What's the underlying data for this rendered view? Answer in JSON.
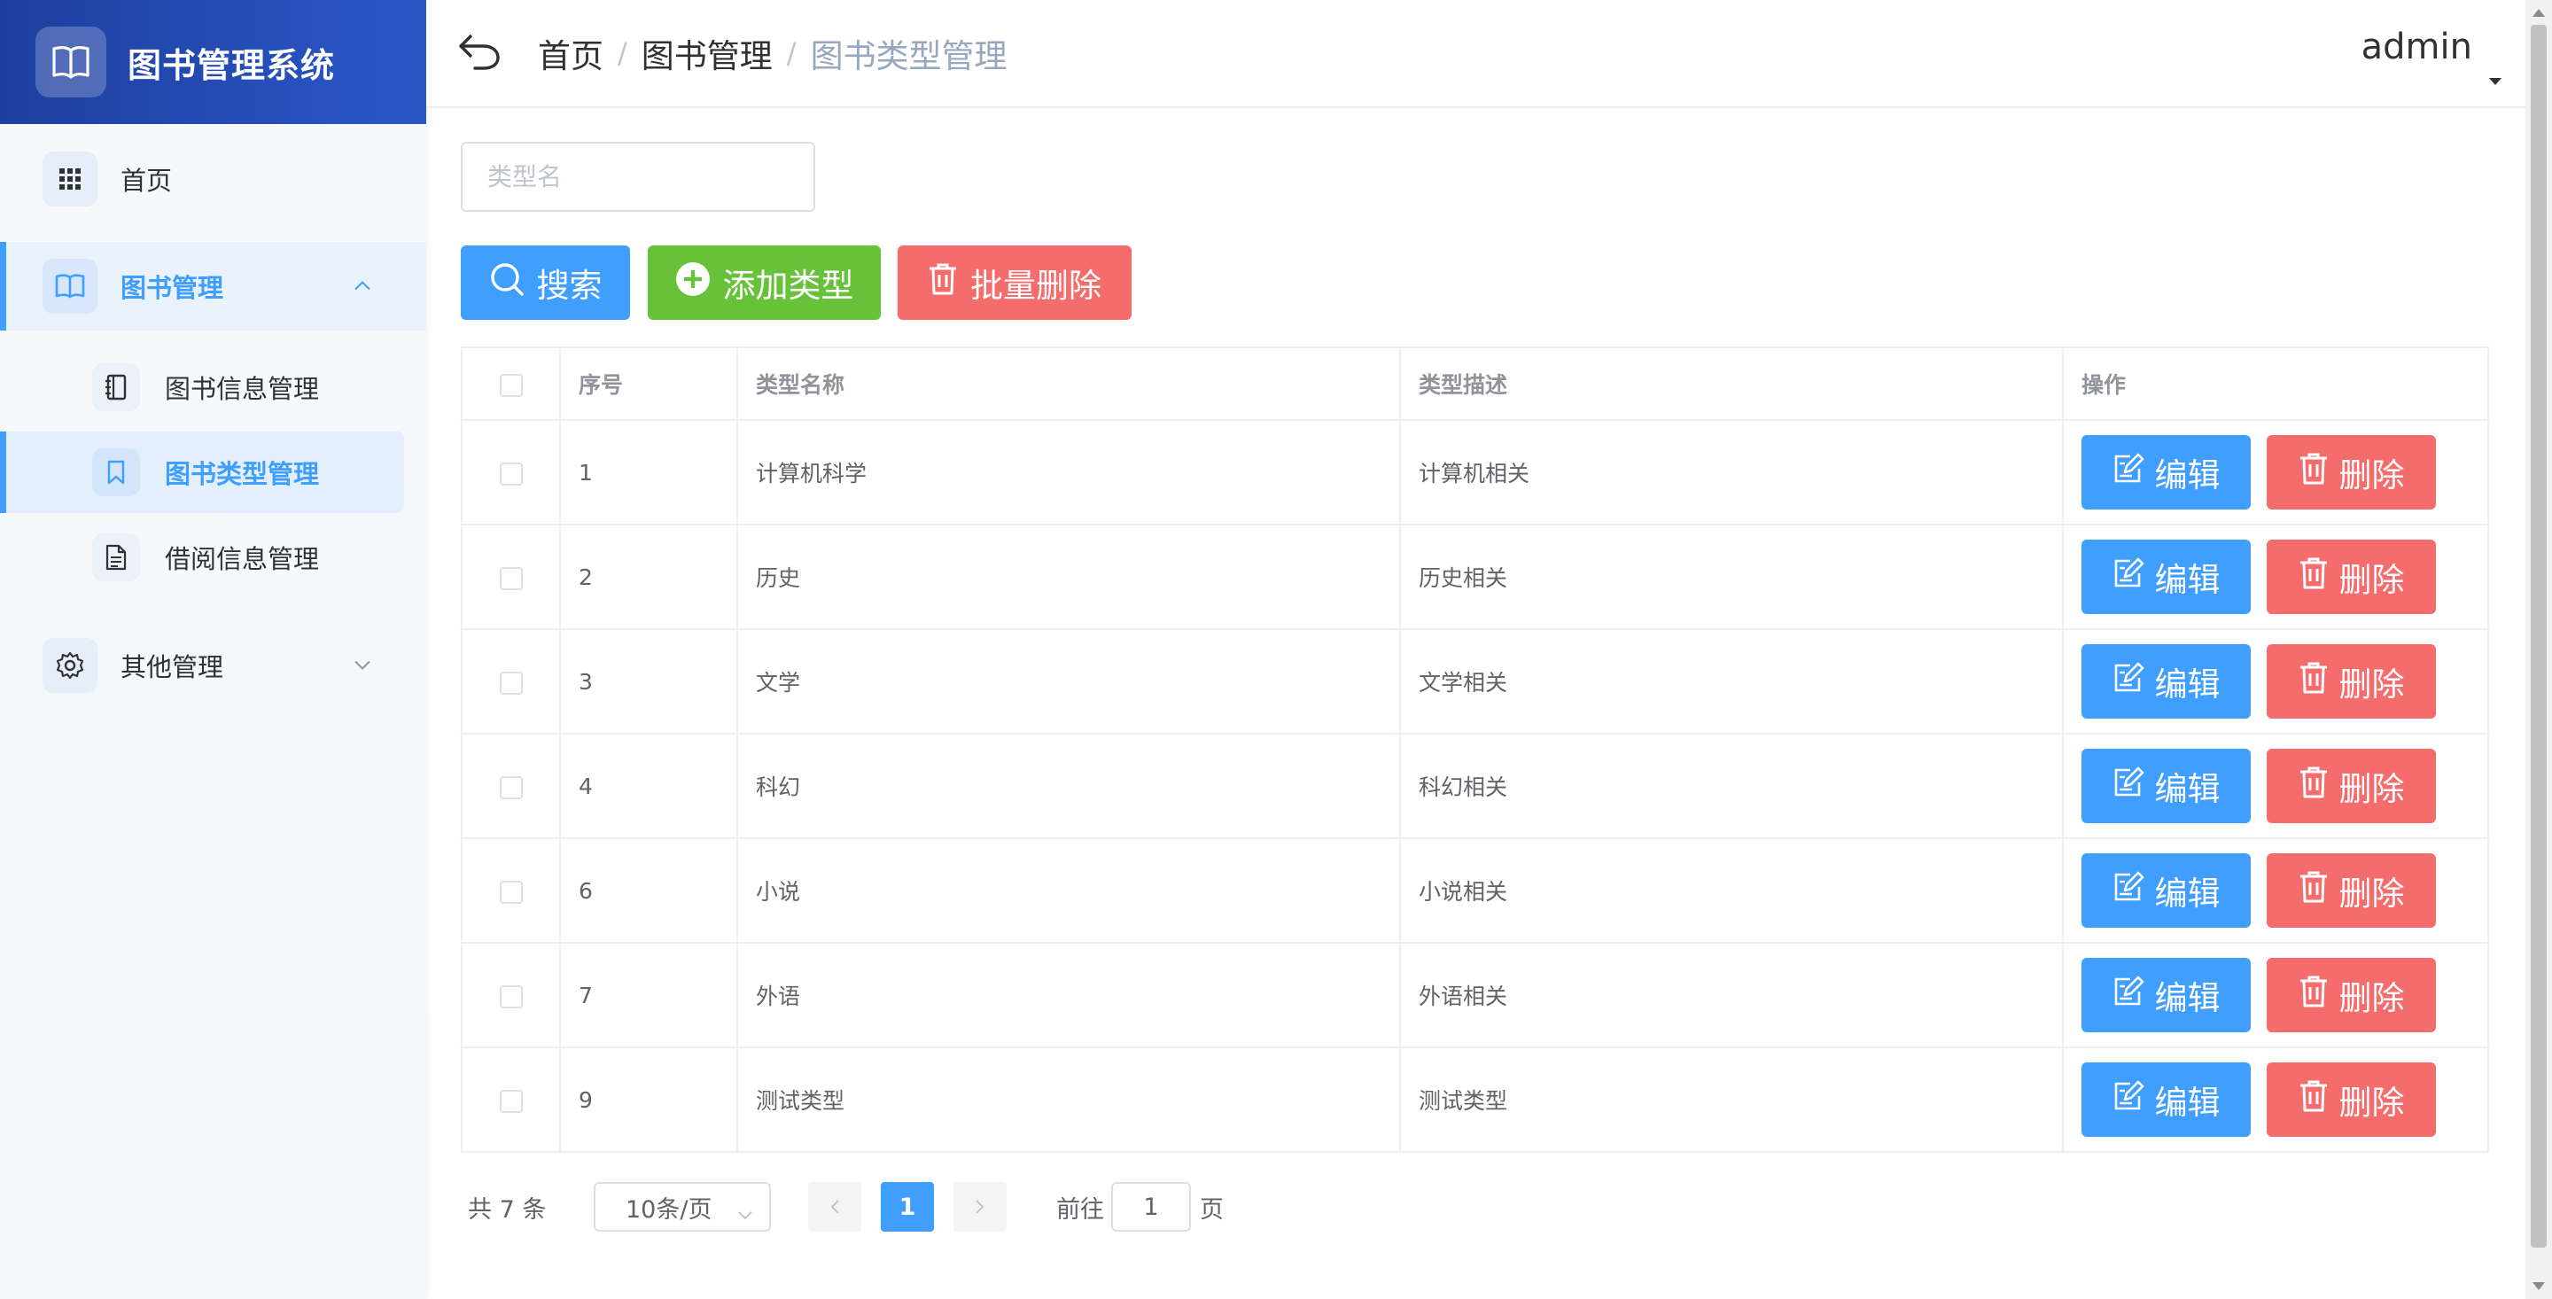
{
  "brand": {
    "title": "图书管理系统",
    "icon": "book-open-icon"
  },
  "sidebar": {
    "items": [
      {
        "label": "首页",
        "icon": "grid-icon"
      },
      {
        "label": "图书管理",
        "icon": "book-open-icon",
        "expanded": true,
        "children": [
          {
            "label": "图书信息管理",
            "icon": "notebook-icon"
          },
          {
            "label": "图书类型管理",
            "icon": "bookmark-icon",
            "active": true
          },
          {
            "label": "借阅信息管理",
            "icon": "document-icon"
          }
        ]
      },
      {
        "label": "其他管理",
        "icon": "gear-icon",
        "expanded": false
      }
    ]
  },
  "header": {
    "breadcrumb": [
      "首页",
      "图书管理",
      "图书类型管理"
    ],
    "separator": "/",
    "user": "admin"
  },
  "search": {
    "placeholder": "类型名",
    "value": ""
  },
  "toolbar": {
    "search_label": "搜索",
    "add_label": "添加类型",
    "batch_delete_label": "批量删除"
  },
  "table": {
    "columns": [
      "序号",
      "类型名称",
      "类型描述",
      "操作"
    ],
    "rows": [
      {
        "id": "1",
        "name": "计算机科学",
        "desc": "计算机相关"
      },
      {
        "id": "2",
        "name": "历史",
        "desc": "历史相关"
      },
      {
        "id": "3",
        "name": "文学",
        "desc": "文学相关"
      },
      {
        "id": "4",
        "name": "科幻",
        "desc": "科幻相关"
      },
      {
        "id": "6",
        "name": "小说",
        "desc": "小说相关"
      },
      {
        "id": "7",
        "name": "外语",
        "desc": "外语相关"
      },
      {
        "id": "9",
        "name": "测试类型",
        "desc": "测试类型"
      }
    ],
    "edit_label": "编辑",
    "delete_label": "删除"
  },
  "pagination": {
    "total_text": "共 7 条",
    "page_size": "10条/页",
    "current_page": "1",
    "goto_label": "前往",
    "goto_value": "1",
    "goto_suffix": "页"
  },
  "colors": {
    "primary": "#409eff",
    "success": "#67c23a",
    "danger": "#f56c6c",
    "brand_dark": "#1e3f9e"
  }
}
